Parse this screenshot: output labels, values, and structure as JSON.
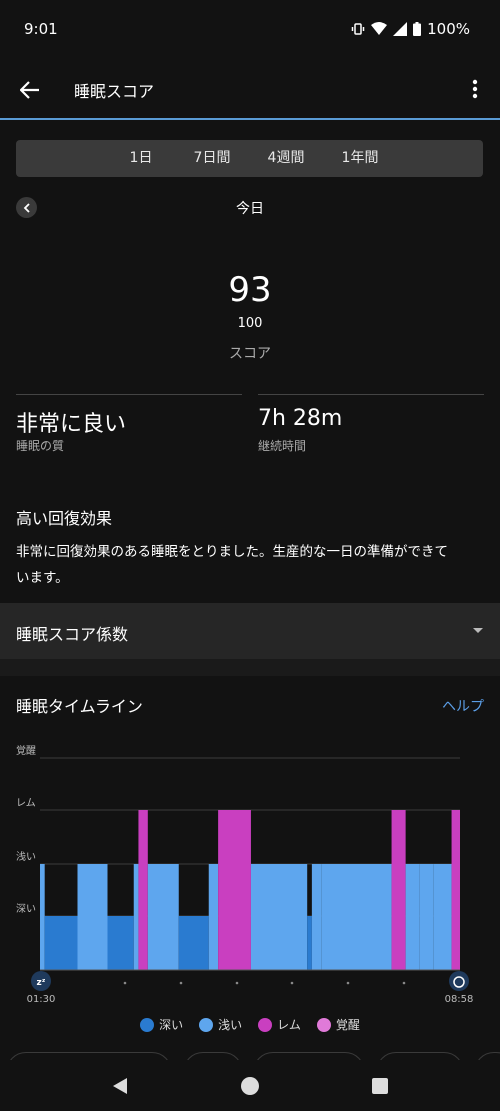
{
  "status": {
    "time": "9:01",
    "battery": "100%"
  },
  "header": {
    "title": "睡眠スコア"
  },
  "tabs": [
    "1日",
    "7日間",
    "4週間",
    "1年間"
  ],
  "date": {
    "label": "今日"
  },
  "score": {
    "value": "93",
    "max": "100",
    "label": "スコア"
  },
  "metrics": {
    "quality": {
      "value": "非常に良い",
      "label": "睡眠の質"
    },
    "duration": {
      "value": "7h 28m",
      "label": "継続時間"
    }
  },
  "recovery": {
    "title": "高い回復効果",
    "line1": "非常に回復効果のある睡眠をとりました。生産的な一日の準備ができて",
    "line2": "います。"
  },
  "factors": {
    "title": "睡眠スコア係数"
  },
  "timeline": {
    "title": "睡眠タイムライン",
    "help": "ヘルプ"
  },
  "colors": {
    "deep": "#2a7bd0",
    "light": "#5ea6ee",
    "rem": "#c93fc0",
    "awake": "#e07ad8",
    "accent": "#5b9ee6"
  },
  "chart_data": {
    "type": "bar",
    "stages": [
      "深い",
      "浅い",
      "レム",
      "覚醒"
    ],
    "y_labels": [
      "覚醒",
      "レム",
      "浅い",
      "深い"
    ],
    "start_label": "01:30",
    "end_label": "08:58",
    "x_range": [
      "01:30",
      "08:58"
    ],
    "segments": [
      {
        "start": "01:30",
        "end": "01:35",
        "stage": "浅い"
      },
      {
        "start": "01:35",
        "end": "02:10",
        "stage": "深い"
      },
      {
        "start": "02:10",
        "end": "02:42",
        "stage": "浅い"
      },
      {
        "start": "02:42",
        "end": "03:10",
        "stage": "深い"
      },
      {
        "start": "03:10",
        "end": "03:15",
        "stage": "浅い"
      },
      {
        "start": "03:15",
        "end": "03:25",
        "stage": "レム"
      },
      {
        "start": "03:25",
        "end": "03:58",
        "stage": "浅い"
      },
      {
        "start": "03:58",
        "end": "04:30",
        "stage": "深い"
      },
      {
        "start": "04:30",
        "end": "04:40",
        "stage": "浅い"
      },
      {
        "start": "04:40",
        "end": "05:15",
        "stage": "レム"
      },
      {
        "start": "05:15",
        "end": "06:15",
        "stage": "浅い"
      },
      {
        "start": "06:15",
        "end": "06:20",
        "stage": "深い"
      },
      {
        "start": "06:20",
        "end": "06:30",
        "stage": "浅い"
      },
      {
        "start": "06:30",
        "end": "07:45",
        "stage": "浅い"
      },
      {
        "start": "07:45",
        "end": "08:00",
        "stage": "レム"
      },
      {
        "start": "08:00",
        "end": "08:15",
        "stage": "浅い"
      },
      {
        "start": "08:15",
        "end": "08:30",
        "stage": "浅い"
      },
      {
        "start": "08:30",
        "end": "08:49",
        "stage": "浅い"
      },
      {
        "start": "08:49",
        "end": "08:58",
        "stage": "レム"
      }
    ]
  }
}
